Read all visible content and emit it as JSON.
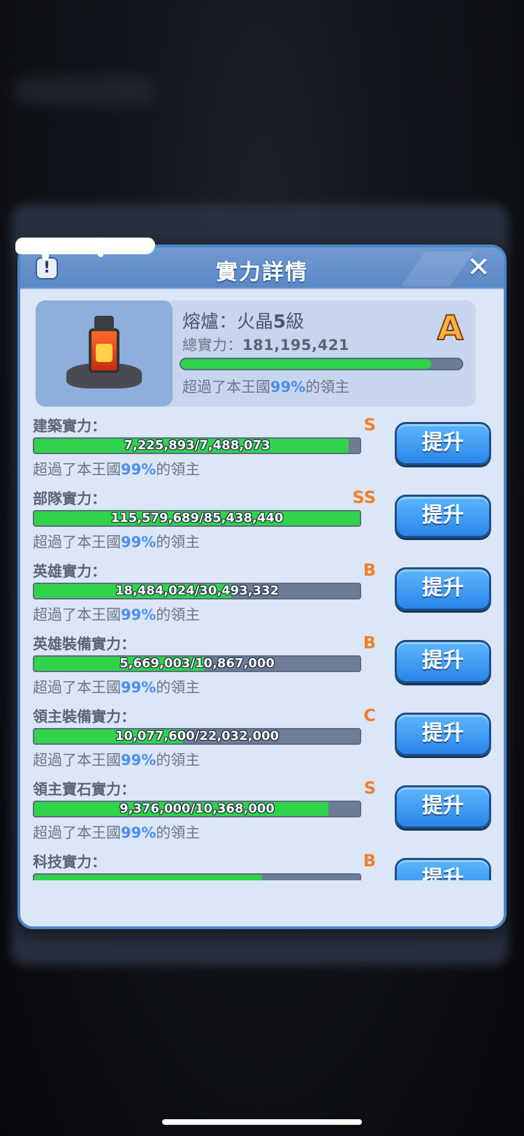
{
  "dialog": {
    "title": "實力詳情",
    "info_icon": "!",
    "close_icon": "✕"
  },
  "summary": {
    "building_name": "熔爐：火晶",
    "building_level": "5",
    "building_level_suffix": "級",
    "total_label": "總實力：",
    "total_value": "181,195,421",
    "grade": "A",
    "progress": 0.89,
    "pct_prefix": "超過了本王國",
    "pct_value": "99%",
    "pct_suffix": "的領主"
  },
  "stats": [
    {
      "label": "建築實力：",
      "grade": "S",
      "value": "7,225,893/7,488,073",
      "progress": 0.965,
      "pct_prefix": "超過了本王國",
      "pct_value": "99%",
      "pct_suffix": "的領主",
      "button": "提升"
    },
    {
      "label": "部隊實力：",
      "grade": "SS",
      "value": "115,579,689/85,438,440",
      "progress": 1.0,
      "pct_prefix": "超過了本王國",
      "pct_value": "99%",
      "pct_suffix": "的領主",
      "button": "提升"
    },
    {
      "label": "英雄實力：",
      "grade": "B",
      "value": "18,484,024/30,493,332",
      "progress": 0.606,
      "pct_prefix": "超過了本王國",
      "pct_value": "99%",
      "pct_suffix": "的領主",
      "button": "提升"
    },
    {
      "label": "英雄裝備實力：",
      "grade": "B",
      "value": "5,669,003/10,867,000",
      "progress": 0.522,
      "pct_prefix": "超過了本王國",
      "pct_value": "99%",
      "pct_suffix": "的領主",
      "button": "提升"
    },
    {
      "label": "領主裝備實力：",
      "grade": "C",
      "value": "10,077,600/22,032,000",
      "progress": 0.457,
      "pct_prefix": "超過了本王國",
      "pct_value": "99%",
      "pct_suffix": "的領主",
      "button": "提升"
    },
    {
      "label": "領主寶石實力：",
      "grade": "S",
      "value": "9,376,000/10,368,000",
      "progress": 0.904,
      "pct_prefix": "超過了本王國",
      "pct_value": "99%",
      "pct_suffix": "的領主",
      "button": "提升"
    },
    {
      "label": "科技實力：",
      "grade": "B",
      "value": "",
      "progress": 0.7,
      "pct_prefix": "",
      "pct_value": "",
      "pct_suffix": "",
      "button": "提升"
    }
  ],
  "colors": {
    "accent_blue": "#4a8ef0",
    "bar_green": "#2fd44a",
    "grade_orange": "#f07e2a",
    "grade_gold": "#ffb23a"
  }
}
